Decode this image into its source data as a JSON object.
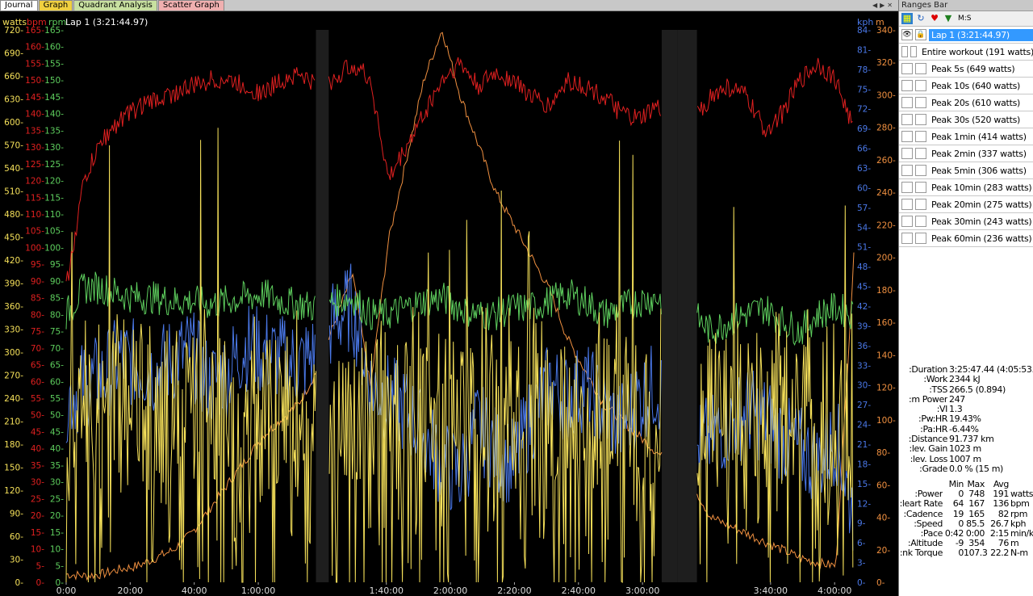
{
  "tabs": [
    {
      "label": "Journal",
      "active": true
    },
    {
      "label": "Graph",
      "active": false,
      "color": "#f0d040"
    },
    {
      "label": "Quadrant Analysis",
      "active": false,
      "color": "#c8e0a0"
    },
    {
      "label": "Scatter Graph",
      "active": false,
      "color": "#f0b0b0"
    }
  ],
  "graph": {
    "lap_label": "Lap 1 (3:21:44.97)",
    "axis_headers": {
      "watts": "watts",
      "bpm": "bpm",
      "rpm": "rpm",
      "kph": "kph",
      "m": "m"
    },
    "colors": {
      "watts": "#f5e05a",
      "bpm": "#e02020",
      "rpm": "#5ecf5e",
      "kph": "#4a78e8",
      "m": "#f09040"
    }
  },
  "chart_data": {
    "type": "line",
    "x_ticks": [
      "0:00",
      "20:00",
      "40:00",
      "1:00:00",
      "1:40:00",
      "2:00:00",
      "2:20:00",
      "2:40:00",
      "3:00:00",
      "3:40:00",
      "4:00:00"
    ],
    "x_tick_minutes": [
      0,
      20,
      40,
      60,
      100,
      120,
      140,
      160,
      180,
      220,
      240
    ],
    "x_range_minutes": [
      0,
      246
    ],
    "gaps_minutes": [
      [
        78,
        82
      ],
      [
        186,
        191
      ],
      [
        191,
        197
      ]
    ],
    "axes": {
      "watts": {
        "min": 0,
        "max": 720,
        "step": 30
      },
      "bpm": {
        "min": 0,
        "max": 165,
        "step": 5
      },
      "rpm": {
        "min": 0,
        "max": 165,
        "step": 5
      },
      "kph": {
        "min": 0,
        "max": 84,
        "step": 3
      },
      "m": {
        "min": 0,
        "max": 340,
        "step": 20
      }
    },
    "series": [
      {
        "name": "watts",
        "axis": "watts",
        "style": "spiky",
        "mean": 191,
        "max": 748
      },
      {
        "name": "bpm",
        "axis": "bpm",
        "min": 64,
        "max": 167,
        "avg": 136,
        "values": [
          88,
          120,
          132,
          138,
          142,
          144,
          146,
          148,
          150,
          150,
          148,
          146,
          150,
          152,
          148,
          150,
          155,
          150,
          120,
          130,
          140,
          150,
          155,
          148,
          152,
          150,
          145,
          142,
          150,
          148,
          145,
          140,
          138,
          142,
          136,
          138,
          145,
          148,
          145,
          135,
          140,
          150,
          155,
          150,
          135
        ]
      },
      {
        "name": "rpm",
        "axis": "rpm",
        "min": 19,
        "max": 165,
        "avg": 82,
        "values": [
          80,
          88,
          88,
          86,
          85,
          85,
          84,
          84,
          83,
          84,
          85,
          86,
          84,
          83,
          82,
          84,
          85,
          80,
          80,
          82,
          84,
          85,
          82,
          80,
          80,
          82,
          82,
          84,
          86,
          84,
          80,
          82,
          84,
          85,
          82,
          80,
          75,
          78,
          80,
          82,
          78,
          75,
          80,
          82,
          80
        ]
      },
      {
        "name": "kph",
        "axis": "kph",
        "min": 0,
        "max": 85.5,
        "avg": 26.7,
        "values": [
          28,
          30,
          31,
          34,
          33,
          32,
          34,
          35,
          30,
          32,
          36,
          35,
          34,
          33,
          35,
          40,
          42,
          30,
          28,
          26,
          22,
          18,
          16,
          24,
          20,
          18,
          25,
          30,
          28,
          30,
          26,
          24,
          28,
          30,
          25,
          20,
          22,
          24,
          26,
          25,
          22,
          20,
          18,
          22,
          10
        ]
      },
      {
        "name": "m",
        "axis": "m",
        "min": -9,
        "max": 354,
        "avg": 76,
        "values": [
          5,
          4,
          5,
          8,
          10,
          15,
          20,
          30,
          45,
          60,
          75,
          90,
          100,
          110,
          130,
          160,
          190,
          120,
          210,
          260,
          310,
          340,
          300,
          270,
          240,
          220,
          200,
          180,
          150,
          130,
          110,
          100,
          90,
          80,
          70,
          60,
          40,
          35,
          30,
          25,
          20,
          15,
          12,
          10,
          200
        ]
      }
    ]
  },
  "sidebar": {
    "title": "Ranges Bar",
    "toolbar_label": "M:S",
    "toolbar_icons": [
      "grid-icon",
      "refresh-icon",
      "heart-icon",
      "funnel-icon"
    ],
    "ranges": [
      {
        "label": "Lap 1 (3:21:44.97)",
        "selected": true
      },
      {
        "label": "Entire workout (191 watts)",
        "selected": false
      },
      {
        "label": "Peak 5s (649 watts)",
        "selected": false
      },
      {
        "label": "Peak 10s (640 watts)",
        "selected": false
      },
      {
        "label": "Peak 20s (610 watts)",
        "selected": false
      },
      {
        "label": "Peak 30s (520 watts)",
        "selected": false
      },
      {
        "label": "Peak 1min (414 watts)",
        "selected": false
      },
      {
        "label": "Peak 2min (337 watts)",
        "selected": false
      },
      {
        "label": "Peak 5min (306 watts)",
        "selected": false
      },
      {
        "label": "Peak 10min (283 watts)",
        "selected": false
      },
      {
        "label": "Peak 20min (275 watts)",
        "selected": false
      },
      {
        "label": "Peak 30min (243 watts)",
        "selected": false
      },
      {
        "label": "Peak 60min (236 watts)",
        "selected": false
      }
    ],
    "summary": [
      {
        "k": "Duration:",
        "v": "3:25:47.44 (4:05:53.00)"
      },
      {
        "k": "Work:",
        "v": "2344 kJ"
      },
      {
        "k": "TSS:",
        "v": "266.5 (0.894)"
      },
      {
        "k": "m Power:",
        "v": "247"
      },
      {
        "k": "VI:",
        "v": "1.3"
      },
      {
        "k": "Pw:HR:",
        "v": "19.43%"
      },
      {
        "k": "Pa:HR:",
        "v": "-6.44%"
      },
      {
        "k": "Distance:",
        "v": "91.737 km"
      },
      {
        "k": "lev. Gain:",
        "v": "1023 m"
      },
      {
        "k": "lev. Loss:",
        "v": "1007 m"
      },
      {
        "k": "Grade:",
        "v": "0.0 % (15 m)"
      }
    ],
    "stats": {
      "header": [
        "Min",
        "Max",
        "Avg"
      ],
      "rows": [
        {
          "k": "Power:",
          "min": "0",
          "max": "748",
          "avg": "191",
          "unit": "watts"
        },
        {
          "k": "leart Rate:",
          "min": "64",
          "max": "167",
          "avg": "136",
          "unit": "bpm"
        },
        {
          "k": "Cadence:",
          "min": "19",
          "max": "165",
          "avg": "82",
          "unit": "rpm"
        },
        {
          "k": "Speed:",
          "min": "0",
          "max": "85.5",
          "avg": "26.7",
          "unit": "kph"
        },
        {
          "k": "Pace:",
          "min": "0:42",
          "max": "0:00",
          "avg": "2:15",
          "unit": "min/km"
        },
        {
          "k": "Altitude:",
          "min": "-9",
          "max": "354",
          "avg": "76",
          "unit": "m"
        },
        {
          "k": "nk Torque:",
          "min": "0",
          "max": "107.3",
          "avg": "22.2",
          "unit": "N-m"
        }
      ]
    }
  }
}
